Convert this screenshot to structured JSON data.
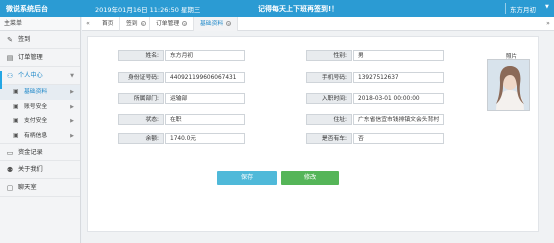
{
  "topbar": {
    "brand": "微说系统后台",
    "datetime": "2019年01月16日 11:26:50 星期三",
    "notice": "记得每天上下班再签到!！",
    "user": "东方月初"
  },
  "sidebar": {
    "title": "主菜单",
    "items": [
      {
        "label": "签到",
        "icon": "edit-icon"
      },
      {
        "label": "订单管理",
        "icon": "order-icon"
      },
      {
        "label": "个人中心",
        "icon": "user-icon"
      },
      {
        "label": "资金记录",
        "icon": "money-icon"
      },
      {
        "label": "关于我们",
        "icon": "team-icon"
      },
      {
        "label": "聊天室",
        "icon": "chat-icon"
      }
    ],
    "sub_items": [
      {
        "label": "基础资料",
        "icon": "card-icon"
      },
      {
        "label": "账号安全",
        "icon": "lock-icon"
      },
      {
        "label": "支付安全",
        "icon": "shield-icon"
      },
      {
        "label": "有柄信息",
        "icon": "phone-icon"
      }
    ]
  },
  "tabs": [
    {
      "label": "首页"
    },
    {
      "label": "签到"
    },
    {
      "label": "订单管理"
    },
    {
      "label": "基础资料"
    }
  ],
  "profile": {
    "name_label": "姓名:",
    "name": "东方月初",
    "gender_label": "性别:",
    "gender": "男",
    "idcard_label": "身份证号码:",
    "idcard": "440921199606067431",
    "phone_label": "手机号码:",
    "phone": "13927512637",
    "dept_label": "所属部门:",
    "dept": "运输部",
    "hiredate_label": "入职时间:",
    "hiredate": "2018-03-01 00:00:00",
    "status_label": "状态:",
    "status": "在职",
    "address_label": "住址:",
    "address": "广东省信宜市钱排镇文会头背村",
    "balance_label": "余额:",
    "balance": "1740.0元",
    "married_label": "是否有车:",
    "married": "否",
    "photo_label": "照片"
  },
  "buttons": {
    "save": "保存",
    "back": "修改"
  },
  "colors": {
    "topbar": "#2b9bd3",
    "save_button": "#4fb9d9",
    "back_button": "#55b558",
    "active": "#1e88c9"
  }
}
